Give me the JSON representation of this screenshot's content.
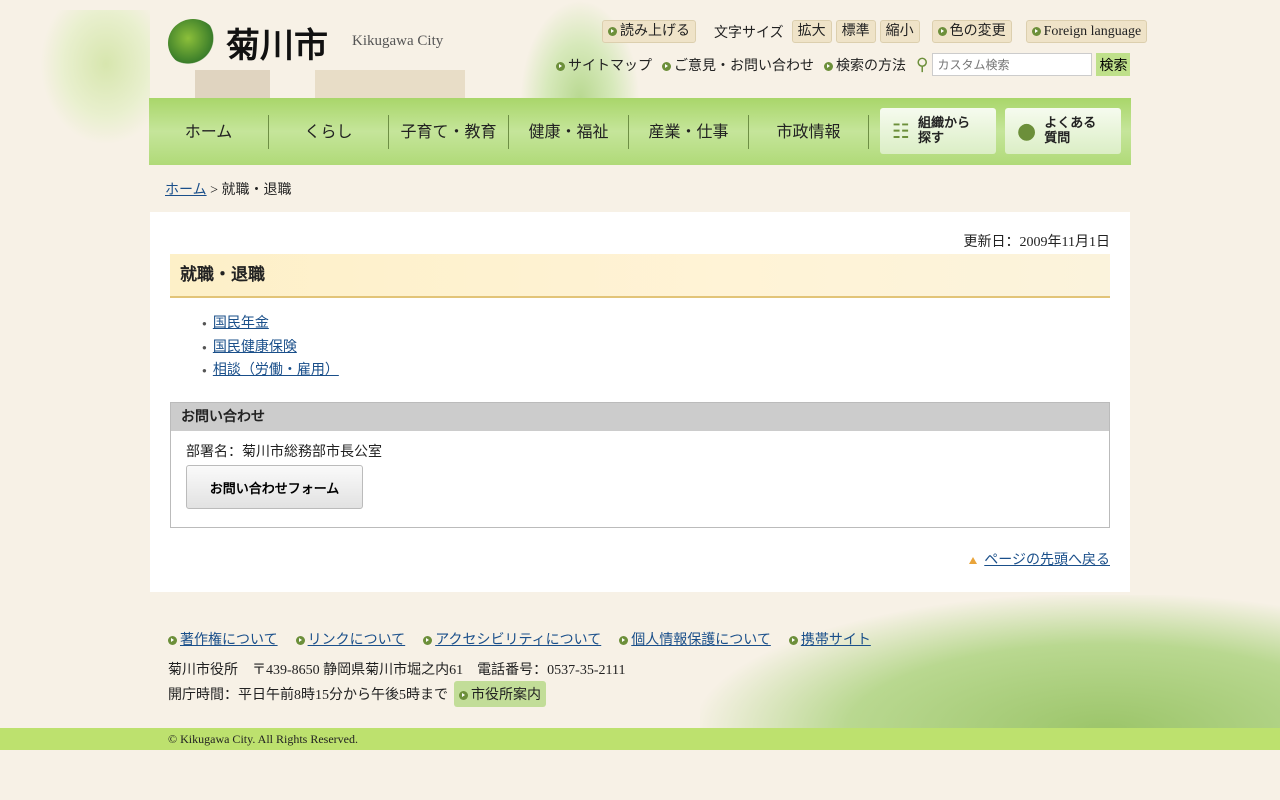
{
  "header": {
    "logo_text": "菊川市",
    "logo_en": "Kikugawa City",
    "read_aloud": "読み上げる",
    "font_size_label": "文字サイズ",
    "font_large": "拡大",
    "font_normal": "標準",
    "font_small": "縮小",
    "color_change": "色の変更",
    "foreign": "Foreign language",
    "sitemap": "サイトマップ",
    "opinion": "ご意見・お問い合わせ",
    "search_howto": "検索の方法",
    "search_placeholder": "カスタム検索",
    "search_btn": "検索"
  },
  "nav": {
    "items": [
      "ホーム",
      "くらし",
      "子育て・教育",
      "健康・福祉",
      "産業・仕事",
      "市政情報"
    ],
    "org_search": "組織から探す",
    "faq": "よくある質問"
  },
  "breadcrumb": {
    "home": "ホーム",
    "sep": ">",
    "current": "就職・退職"
  },
  "main": {
    "updated": "更新日：2009年11月1日",
    "title": "就職・退職",
    "links": [
      "国民年金",
      "国民健康保険",
      "相談（労働・雇用）"
    ],
    "contact_heading": "お問い合わせ",
    "department": "部署名：菊川市総務部市長公室",
    "form_button": "お問い合わせフォーム",
    "back_to_top": "ページの先頭へ戻る"
  },
  "footer": {
    "links": [
      "著作権について",
      "リンクについて",
      "アクセシビリティについて",
      "個人情報保護について",
      "携帯サイト"
    ],
    "address": "菊川市役所　〒439-8650 静岡県菊川市堀之内61　電話番号：0537-35-2111",
    "hours": "開庁時間：平日午前8時15分から午後5時まで",
    "guide": "市役所案内",
    "copyright": "© Kikugawa City. All Rights Reserved."
  }
}
